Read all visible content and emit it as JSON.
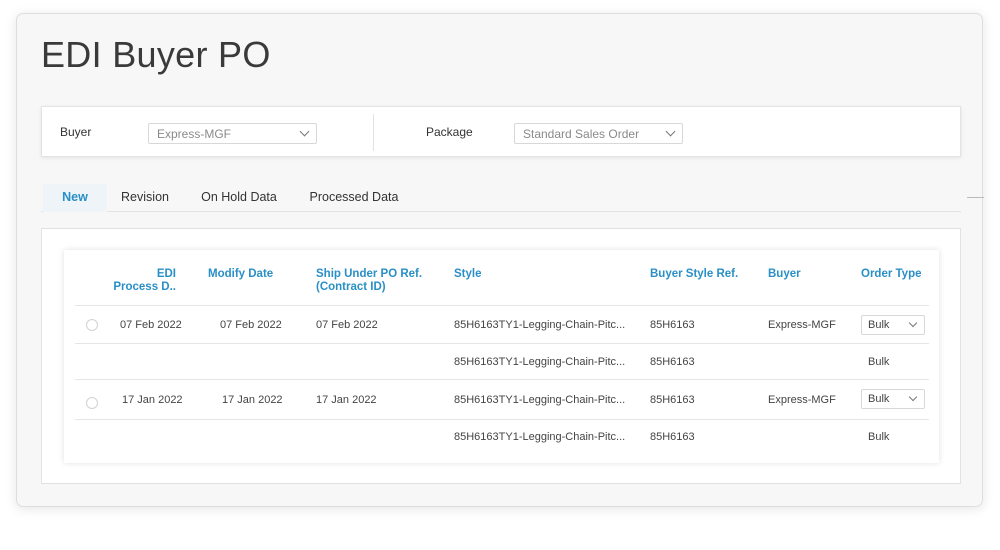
{
  "page": {
    "title": "EDI Buyer PO"
  },
  "filters": {
    "buyer_label": "Buyer",
    "buyer_value": "Express-MGF",
    "package_label": "Package",
    "package_value": "Standard Sales Order"
  },
  "tabs": [
    {
      "label": "New",
      "active": true
    },
    {
      "label": "Revision",
      "active": false
    },
    {
      "label": "On Hold Data",
      "active": false
    },
    {
      "label": "Processed Data",
      "active": false
    }
  ],
  "table": {
    "headers": {
      "process_date_line1": "EDI",
      "process_date_line2": "Process D..",
      "modify_date": "Modify Date",
      "ship_under_line1": "Ship Under PO Ref.",
      "ship_under_line2": "(Contract ID)",
      "style": "Style",
      "buyer_style_ref": "Buyer Style Ref.",
      "buyer": "Buyer",
      "order_type": "Order Type"
    },
    "rows": [
      {
        "process_date": "07 Feb 2022",
        "modify_date": "07 Feb 2022",
        "ship_under": "07 Feb 2022",
        "style": "85H6163TY1-Legging-Chain-Pitc...",
        "buyer_style_ref": "85H6163",
        "buyer": "Express-MGF",
        "order_type": "Bulk"
      },
      {
        "style": "85H6163TY1-Legging-Chain-Pitc...",
        "buyer_style_ref": "85H6163",
        "order_type": "Bulk"
      },
      {
        "process_date": "17 Jan 2022",
        "modify_date": "17 Jan 2022",
        "ship_under": "17 Jan 2022",
        "style": "85H6163TY1-Legging-Chain-Pitc...",
        "buyer_style_ref": "85H6163",
        "buyer": "Express-MGF",
        "order_type": "Bulk"
      },
      {
        "style": "85H6163TY1-Legging-Chain-Pitc...",
        "buyer_style_ref": "85H6163",
        "order_type": "Bulk"
      }
    ]
  },
  "colors": {
    "accent": "#2a8fc6",
    "text": "#333333",
    "border": "#e2e2e2"
  }
}
